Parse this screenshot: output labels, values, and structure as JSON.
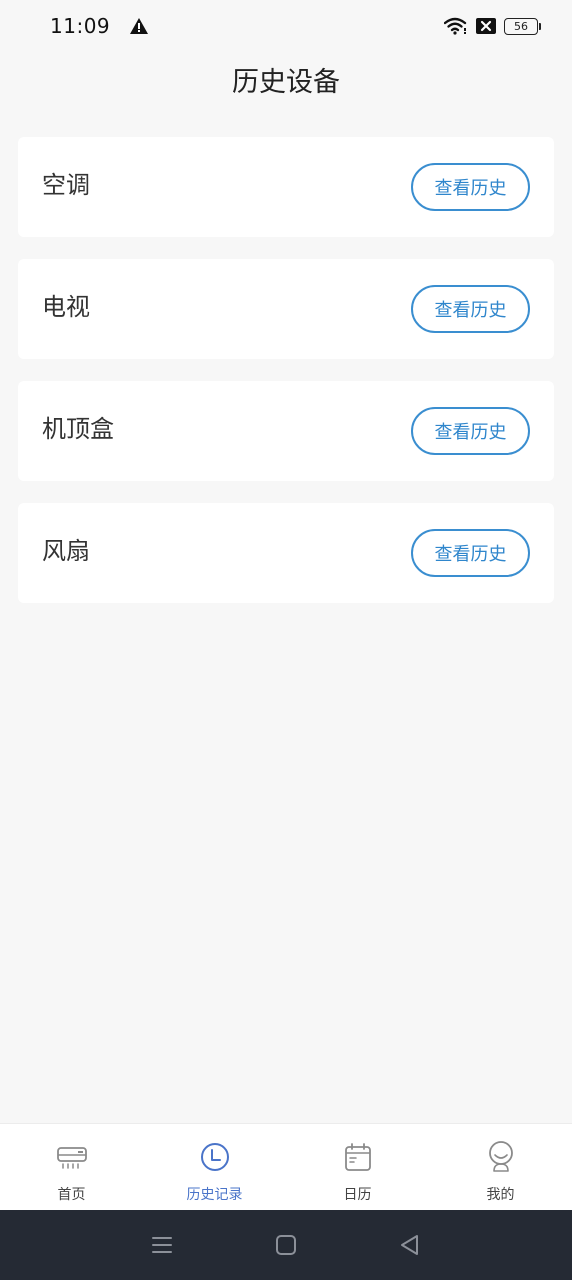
{
  "status_bar": {
    "time": "11:09",
    "battery_level": "56",
    "icons": [
      "warning-icon",
      "wifi-icon",
      "sim-off-icon",
      "battery-icon"
    ]
  },
  "header": {
    "title": "历史设备"
  },
  "devices": [
    {
      "name": "空调",
      "action_label": "查看历史"
    },
    {
      "name": "电视",
      "action_label": "查看历史"
    },
    {
      "name": "机顶盒",
      "action_label": "查看历史"
    },
    {
      "name": "风扇",
      "action_label": "查看历史"
    }
  ],
  "tab_bar": {
    "tabs": [
      {
        "label": "首页",
        "icon": "air-conditioner-icon",
        "active": false
      },
      {
        "label": "历史记录",
        "icon": "clock-icon",
        "active": true
      },
      {
        "label": "日历",
        "icon": "calendar-icon",
        "active": false
      },
      {
        "label": "我的",
        "icon": "profile-icon",
        "active": false
      }
    ]
  },
  "nav_bar": {
    "icons": [
      "menu-icon",
      "home-icon",
      "back-icon"
    ]
  },
  "colors": {
    "accent": "#3a8ed0",
    "tab_active": "#4a74c9",
    "background": "#f7f7f7",
    "nav_bar": "#252a34"
  }
}
